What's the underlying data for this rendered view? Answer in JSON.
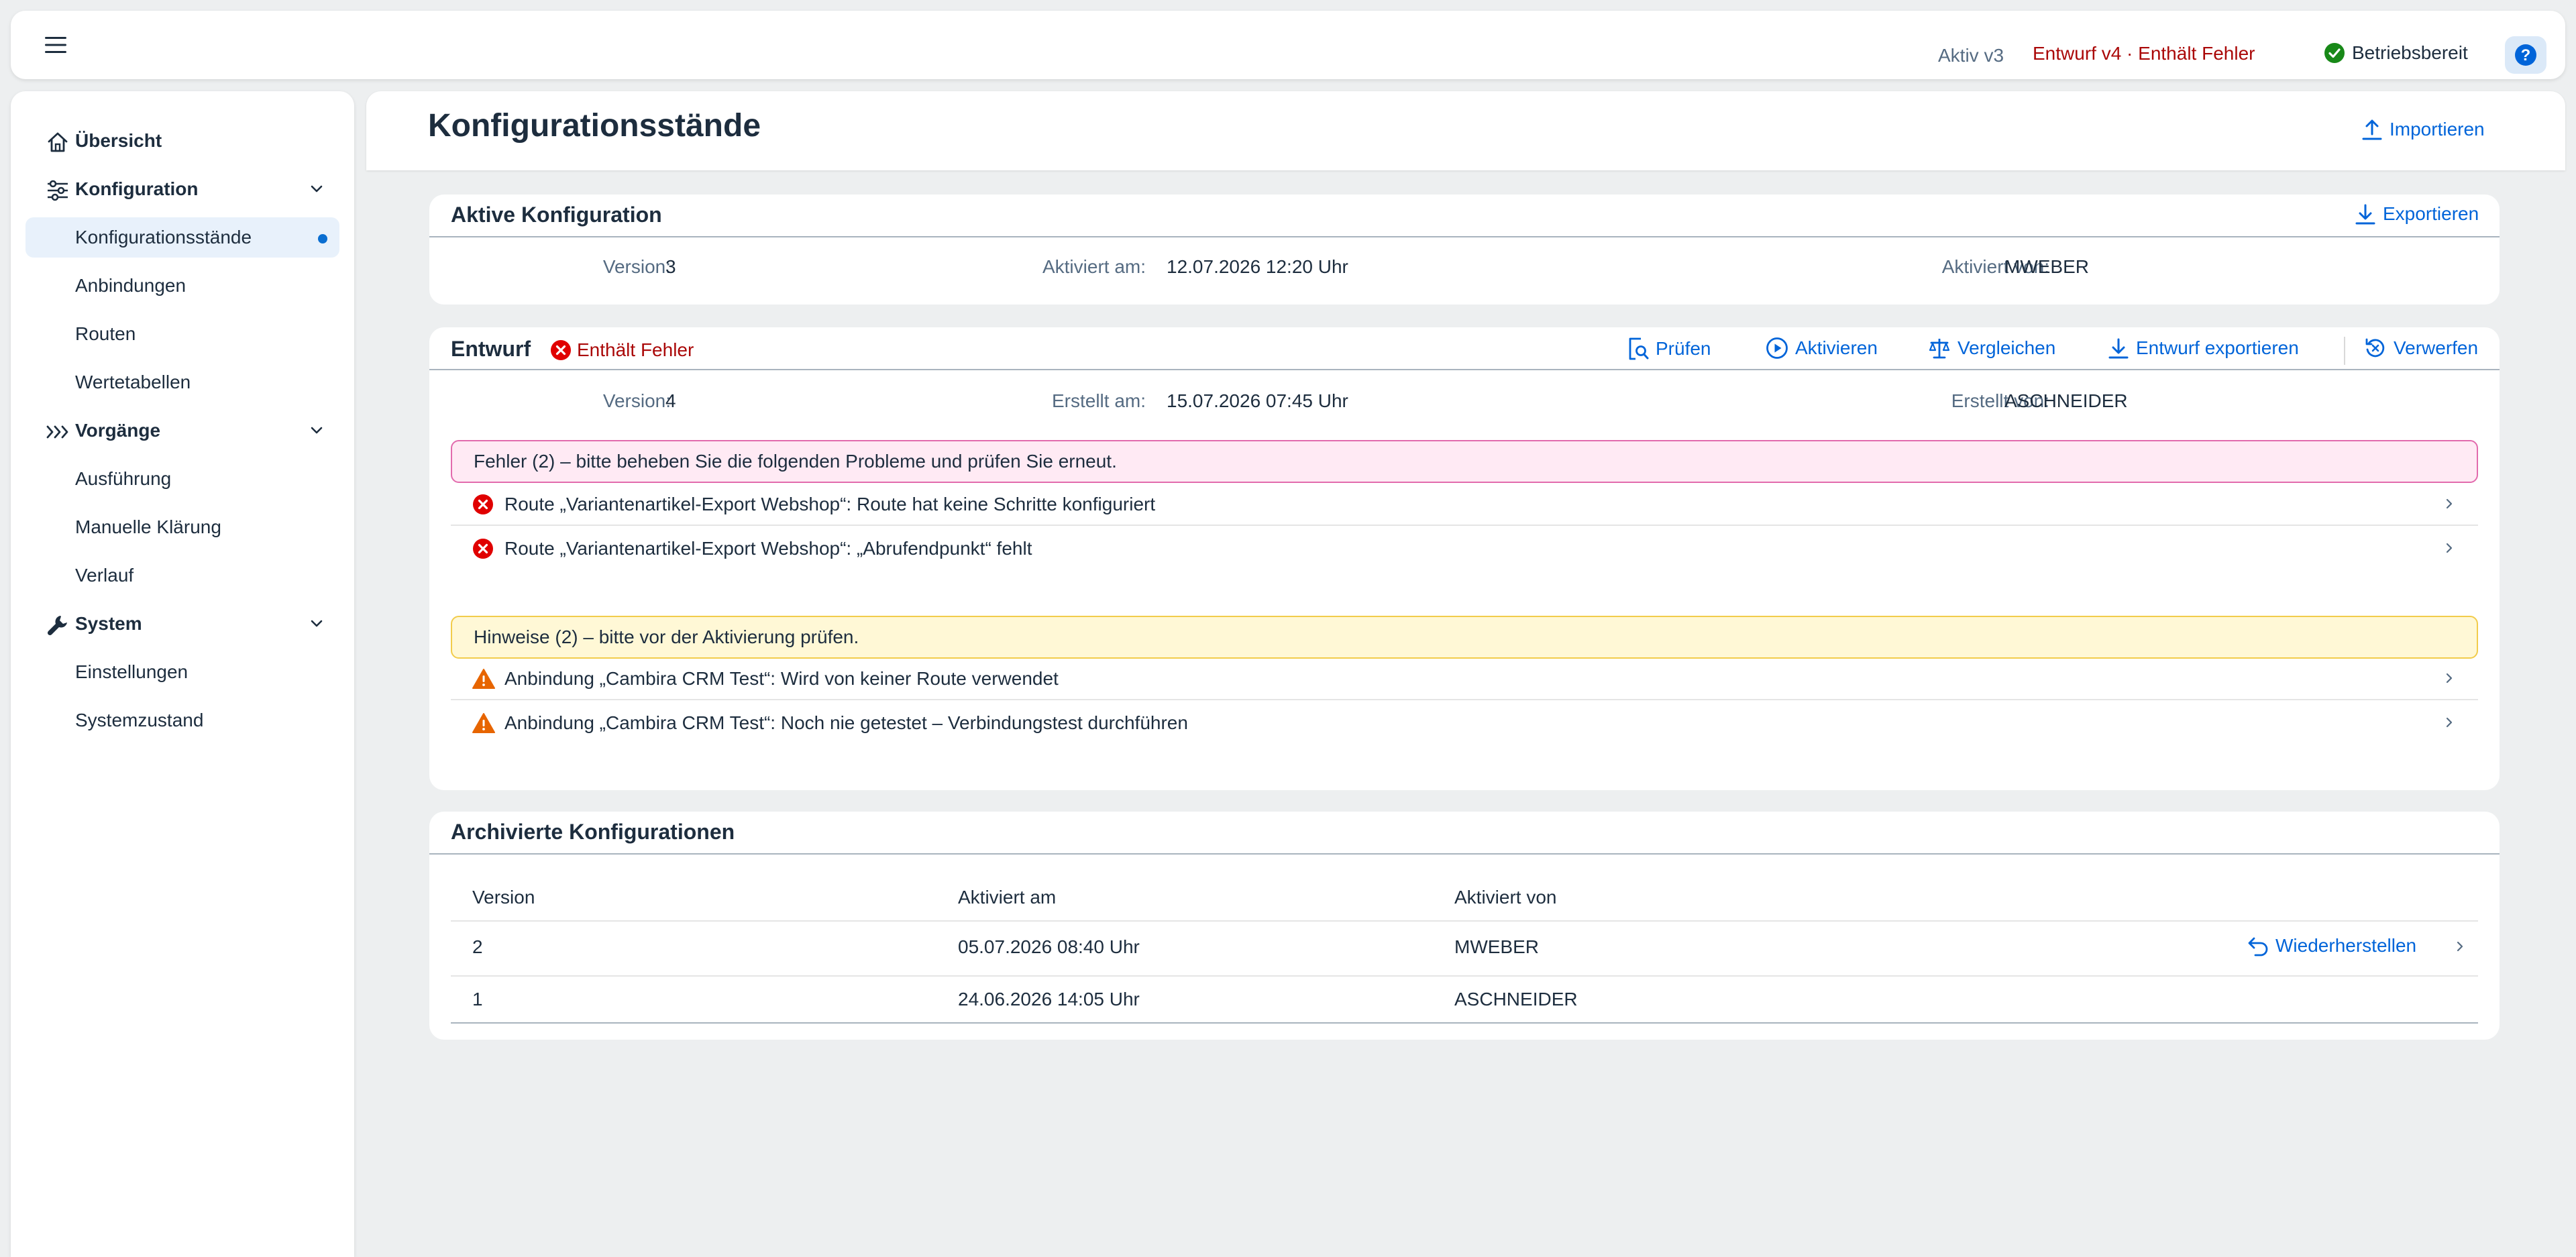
{
  "shellbar": {
    "aktiv_label": "Aktiv v3",
    "entwurf_label": "Entwurf v4 · Enthält Fehler",
    "status_label": "Betriebsbereit",
    "help_label": "?"
  },
  "sidebar": {
    "items": [
      {
        "label": "Übersicht",
        "icon": "home-icon"
      },
      {
        "label": "Konfiguration",
        "icon": "settings-sliders-icon"
      },
      {
        "label": "Konfigurationsstände"
      },
      {
        "label": "Anbindungen"
      },
      {
        "label": "Routen"
      },
      {
        "label": "Wertetabellen"
      },
      {
        "label": "Vorgänge",
        "icon": "process-chevrons-icon"
      },
      {
        "label": "Ausführung"
      },
      {
        "label": "Manuelle Klärung"
      },
      {
        "label": "Verlauf"
      },
      {
        "label": "System",
        "icon": "wrench-icon"
      },
      {
        "label": "Einstellungen"
      },
      {
        "label": "Systemzustand"
      }
    ]
  },
  "page": {
    "title": "Konfigurationsstände",
    "import_label": "Importieren"
  },
  "active_config": {
    "title": "Aktive Konfiguration",
    "export_label": "Exportieren",
    "version_label": "Version:",
    "version_value": "3",
    "activated_at_label": "Aktiviert am:",
    "activated_at_value": "12.07.2026 12:20 Uhr",
    "activated_by_label": "Aktiviert von:",
    "activated_by_value": "MWEBER"
  },
  "draft": {
    "title": "Entwurf",
    "error_badge": "Enthält Fehler",
    "actions": {
      "check": "Prüfen",
      "activate": "Aktivieren",
      "compare": "Vergleichen",
      "export": "Entwurf exportieren",
      "discard": "Verwerfen"
    },
    "version_label": "Version:",
    "version_value": "4",
    "created_at_label": "Erstellt am:",
    "created_at_value": "15.07.2026 07:45 Uhr",
    "created_by_label": "Erstellt von:",
    "created_by_value": "ASCHNEIDER",
    "error_strip": "Fehler (2) – bitte beheben Sie die folgenden Probleme und prüfen Sie erneut.",
    "errors": [
      "Route „Variantenartikel-Export Webshop“: Route hat keine Schritte konfiguriert",
      "Route „Variantenartikel-Export Webshop“: „Abrufendpunkt“ fehlt"
    ],
    "warning_strip": "Hinweise (2) – bitte vor der Aktivierung prüfen.",
    "warnings": [
      "Anbindung „Cambira CRM Test“: Wird von keiner Route verwendet",
      "Anbindung „Cambira CRM Test“: Noch nie getestet – Verbindungstest durchführen"
    ]
  },
  "archive": {
    "title": "Archivierte Konfigurationen",
    "columns": [
      "Version",
      "Aktiviert am",
      "Aktiviert von"
    ],
    "rows": [
      {
        "version": "2",
        "activated_at": "05.07.2026 08:40 Uhr",
        "activated_by": "MWEBER",
        "restore_label": "Wiederherstellen"
      },
      {
        "version": "1",
        "activated_at": "24.06.2026 14:05 Uhr",
        "activated_by": "ASCHNEIDER"
      }
    ]
  },
  "colors": {
    "accent": "#0064d9",
    "error": "#aa0808",
    "error_icon": "#e00000",
    "warning_icon": "#e76500",
    "success": "#188918"
  }
}
